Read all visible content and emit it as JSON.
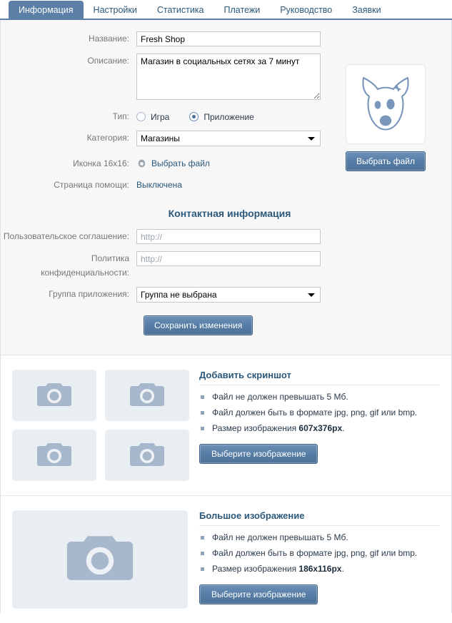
{
  "tabs": [
    {
      "label": "Информация",
      "active": true
    },
    {
      "label": "Настройки",
      "active": false
    },
    {
      "label": "Статистика",
      "active": false
    },
    {
      "label": "Платежи",
      "active": false
    },
    {
      "label": "Руководство",
      "active": false
    },
    {
      "label": "Заявки",
      "active": false
    }
  ],
  "form": {
    "title_label": "Название:",
    "title_value": "Fresh Shop",
    "description_label": "Описание:",
    "description_value": "Магазин в социальных сетях за 7 минут",
    "type_label": "Тип:",
    "type_options": [
      {
        "label": "Игра",
        "selected": false
      },
      {
        "label": "Приложение",
        "selected": true
      }
    ],
    "category_label": "Категория:",
    "category_value": "Магазины",
    "icon_label": "Иконка 16x16:",
    "icon_link": "Выбрать файл",
    "icon_glyph": "gear-icon",
    "help_label": "Страница помощи:",
    "help_value": "Выключена",
    "contact_heading": "Контактная информация",
    "terms_label": "Пользовательское соглашение:",
    "terms_placeholder": "http://",
    "terms_value": "",
    "privacy_label": "Политика конфиденциальности:",
    "privacy_placeholder": "http://",
    "privacy_value": "",
    "group_label": "Группа приложения:",
    "group_value": "Группа не выбрана",
    "save_label": "Сохранить изменения"
  },
  "avatar": {
    "icon": "dog-placeholder-icon",
    "button_label": "Выбрать файл"
  },
  "screenshots": {
    "heading": "Добавить скриншот",
    "rules": [
      {
        "text_before": "Файл не должен превышать 5 Мб.",
        "bold": "",
        "text_after": ""
      },
      {
        "text_before": "Файл должен быть в формате jpg, png, gif или bmp.",
        "bold": "",
        "text_after": ""
      },
      {
        "text_before": "Размер изображения ",
        "bold": "607x376px",
        "text_after": "."
      }
    ],
    "button_label": "Выберите изображение",
    "thumb_count": 4,
    "thumb_icon": "camera-icon"
  },
  "big_image": {
    "heading": "Большое изображение",
    "rules": [
      {
        "text_before": "Файл не должен превышать 5 Мб.",
        "bold": "",
        "text_after": ""
      },
      {
        "text_before": "Файл должен быть в формате jpg, png, gif или bmp.",
        "bold": "",
        "text_after": ""
      },
      {
        "text_before": "Размер изображения ",
        "bold": "186x116px",
        "text_after": "."
      }
    ],
    "button_label": "Выберите изображение",
    "thumb_icon": "camera-icon"
  },
  "colors": {
    "accent": "#5b7fa6",
    "link": "#2b587a",
    "panel_bg": "#f7f7f7",
    "placeholder_bg": "#e9eef3",
    "camera": "#a8b8cc"
  }
}
